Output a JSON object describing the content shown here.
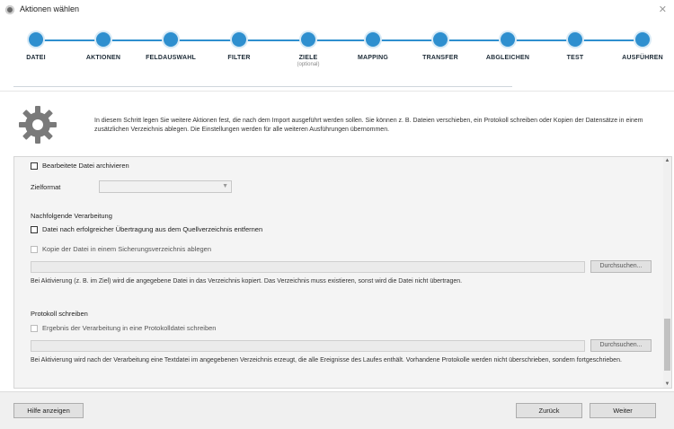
{
  "window": {
    "title": "Aktionen wählen",
    "icon": "app-gear-icon",
    "close_glyph": "✕"
  },
  "stepper": {
    "accent": "#2e8fcf",
    "steps": [
      {
        "label": "DATEI",
        "sublabel": ""
      },
      {
        "label": "AKTIONEN",
        "sublabel": ""
      },
      {
        "label": "FELDAUSWAHL",
        "sublabel": ""
      },
      {
        "label": "FILTER",
        "sublabel": ""
      },
      {
        "label": "ZIELE",
        "sublabel": "(optional)"
      },
      {
        "label": "MAPPING",
        "sublabel": ""
      },
      {
        "label": "TRANSFER",
        "sublabel": ""
      },
      {
        "label": "ABGLEICHEN",
        "sublabel": ""
      },
      {
        "label": "TEST",
        "sublabel": ""
      },
      {
        "label": "AUSFÜHREN",
        "sublabel": ""
      }
    ]
  },
  "info": {
    "icon": "gear-icon",
    "text": "In diesem Schritt legen Sie weitere Aktionen fest, die nach dem Import ausgeführt werden sollen. Sie können z. B. Dateien verschieben, ein Protokoll schreiben oder Kopien der Datensätze in einem zusätzlichen Verzeichnis ablegen. Die Einstellungen werden für alle weiteren Ausführungen übernommen."
  },
  "panel": {
    "option_a_label": "Bearbeitete Datei archivieren",
    "option_a_checked": false,
    "target_label": "Zielformat",
    "target_value": "",
    "section_post": "Nachfolgende Verarbeitung",
    "option_b_label": "Datei nach erfolgreicher Übertragung aus dem Quellverzeichnis entfernen",
    "option_b_checked": false,
    "option_c_label": "Kopie der Datei in einem Sicherungsverzeichnis ablegen",
    "option_c_checked": false,
    "path_c_value": "",
    "browse_c_label": "Durchsuchen...",
    "note_c": "Bei Aktivierung (z. B. im Ziel) wird die angegebene Datei in das Verzeichnis kopiert. Das Verzeichnis muss existieren, sonst wird die Datei nicht übertragen.",
    "section_log": "Protokoll schreiben",
    "option_d_label": "Ergebnis der Verarbeitung in eine Protokolldatei schreiben",
    "option_d_checked": false,
    "path_d_value": "",
    "browse_d_label": "Durchsuchen...",
    "note_d": "Bei Aktivierung wird nach der Verarbeitung eine Textdatei im angegebenen Verzeichnis erzeugt, die alle Ereignisse des Laufes enthält. Vorhandene Protokolle werden nicht überschrieben, sondern fortgeschrieben."
  },
  "footer": {
    "help_label": "Hilfe anzeigen",
    "back_label": "Zurück",
    "next_label": "Weiter"
  }
}
